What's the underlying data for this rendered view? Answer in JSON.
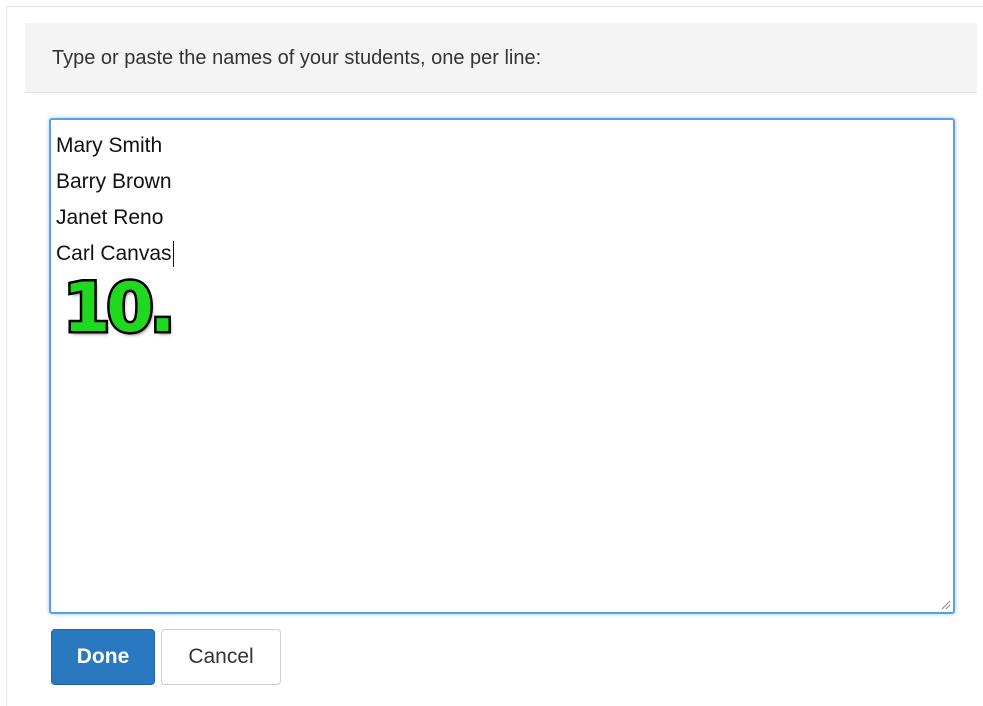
{
  "dialog": {
    "instruction": "Type or paste the names of your students, one per line:",
    "names": [
      "Mary Smith",
      "Barry Brown",
      "Janet Reno",
      "Carl Canvas"
    ],
    "step_annotation": "10.",
    "done_label": "Done",
    "cancel_label": "Cancel"
  },
  "colors": {
    "done_button": "#2a78c0",
    "textarea_focus": "#59a0ea",
    "annotation_green": "#1fd81f",
    "header_bg": "#f4f4f4"
  },
  "icons": {
    "resize": "resize-grip-icon"
  }
}
